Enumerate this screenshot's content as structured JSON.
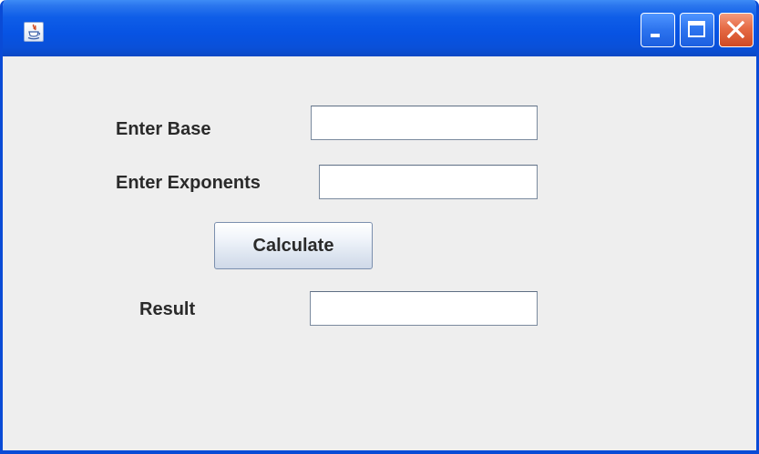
{
  "window": {
    "title": "",
    "icon": "java-coffee-cup-icon",
    "controls": [
      "minimize-icon",
      "maximize-icon",
      "close-icon"
    ],
    "colors": {
      "titlebar": "#0753e3",
      "content_background": "#eeeeee",
      "close_button": "#e66b45"
    }
  },
  "form": {
    "base_label": "Enter Base",
    "base_value": "",
    "exponent_label": "Enter Exponents",
    "exponent_value": "",
    "calculate_label": "Calculate",
    "result_label": "Result",
    "result_value": ""
  }
}
